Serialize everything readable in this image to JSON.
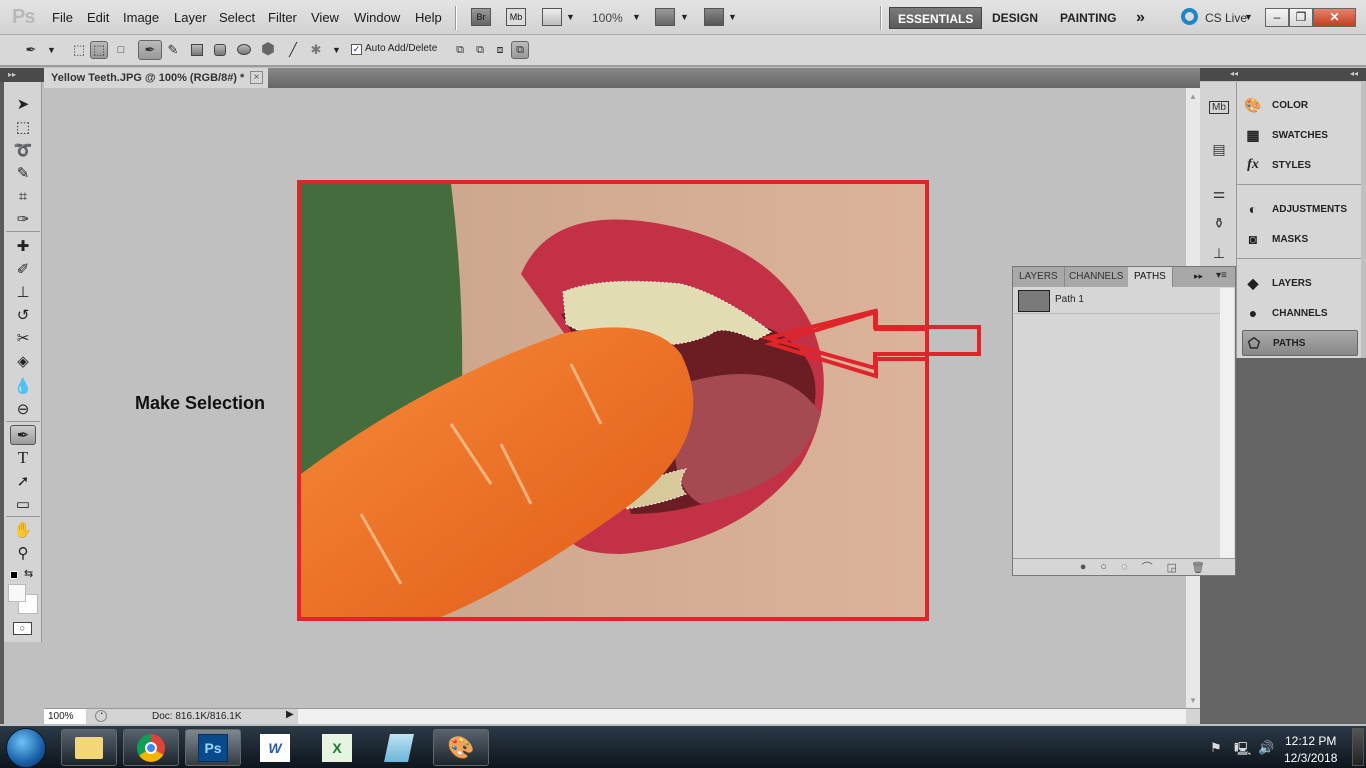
{
  "app": {
    "logo": "Ps"
  },
  "menu": [
    "File",
    "Edit",
    "Image",
    "Layer",
    "Select",
    "Filter",
    "View",
    "Window",
    "Help"
  ],
  "app_bar": {
    "bridge": "Br",
    "mini_bridge": "Mb",
    "zoom": "100%"
  },
  "workspaces": {
    "essentials": "ESSENTIALS",
    "design": "DESIGN",
    "painting": "PAINTING",
    "more": "»"
  },
  "cs_live": "CS Live",
  "options": {
    "auto_add_delete": "Auto Add/Delete",
    "auto_add_checked": true
  },
  "document": {
    "tab_title": "Yellow Teeth.JPG @ 100% (RGB/8#) *",
    "close": "×"
  },
  "annotation": {
    "label": "Make Selection",
    "color": "#e0242a"
  },
  "status": {
    "zoom": "100%",
    "doc_size": "Doc: 816.1K/816.1K"
  },
  "dock": {
    "items": [
      {
        "label": "COLOR",
        "icon": "palette-icon"
      },
      {
        "label": "SWATCHES",
        "icon": "swatches-grid-icon"
      },
      {
        "label": "STYLES",
        "icon": "fx-styles-icon"
      },
      {
        "label": "ADJUSTMENTS",
        "icon": "adjustments-icon"
      },
      {
        "label": "MASKS",
        "icon": "mask-icon"
      },
      {
        "label": "LAYERS",
        "icon": "layers-icon"
      },
      {
        "label": "CHANNELS",
        "icon": "channels-icon"
      },
      {
        "label": "PATHS",
        "icon": "paths-icon",
        "selected": true
      }
    ]
  },
  "paths_panel": {
    "tabs": [
      "LAYERS",
      "CHANNELS",
      "PATHS"
    ],
    "active_tab": "PATHS",
    "paths": [
      {
        "name": "Path 1"
      }
    ]
  },
  "taskbar": {
    "apps": [
      "Windows Explorer",
      "Google Chrome",
      "Adobe Photoshop",
      "Microsoft Word",
      "Microsoft Excel",
      "Notepad",
      "Paint"
    ],
    "time": "12:12 PM",
    "date": "12/3/2018"
  }
}
